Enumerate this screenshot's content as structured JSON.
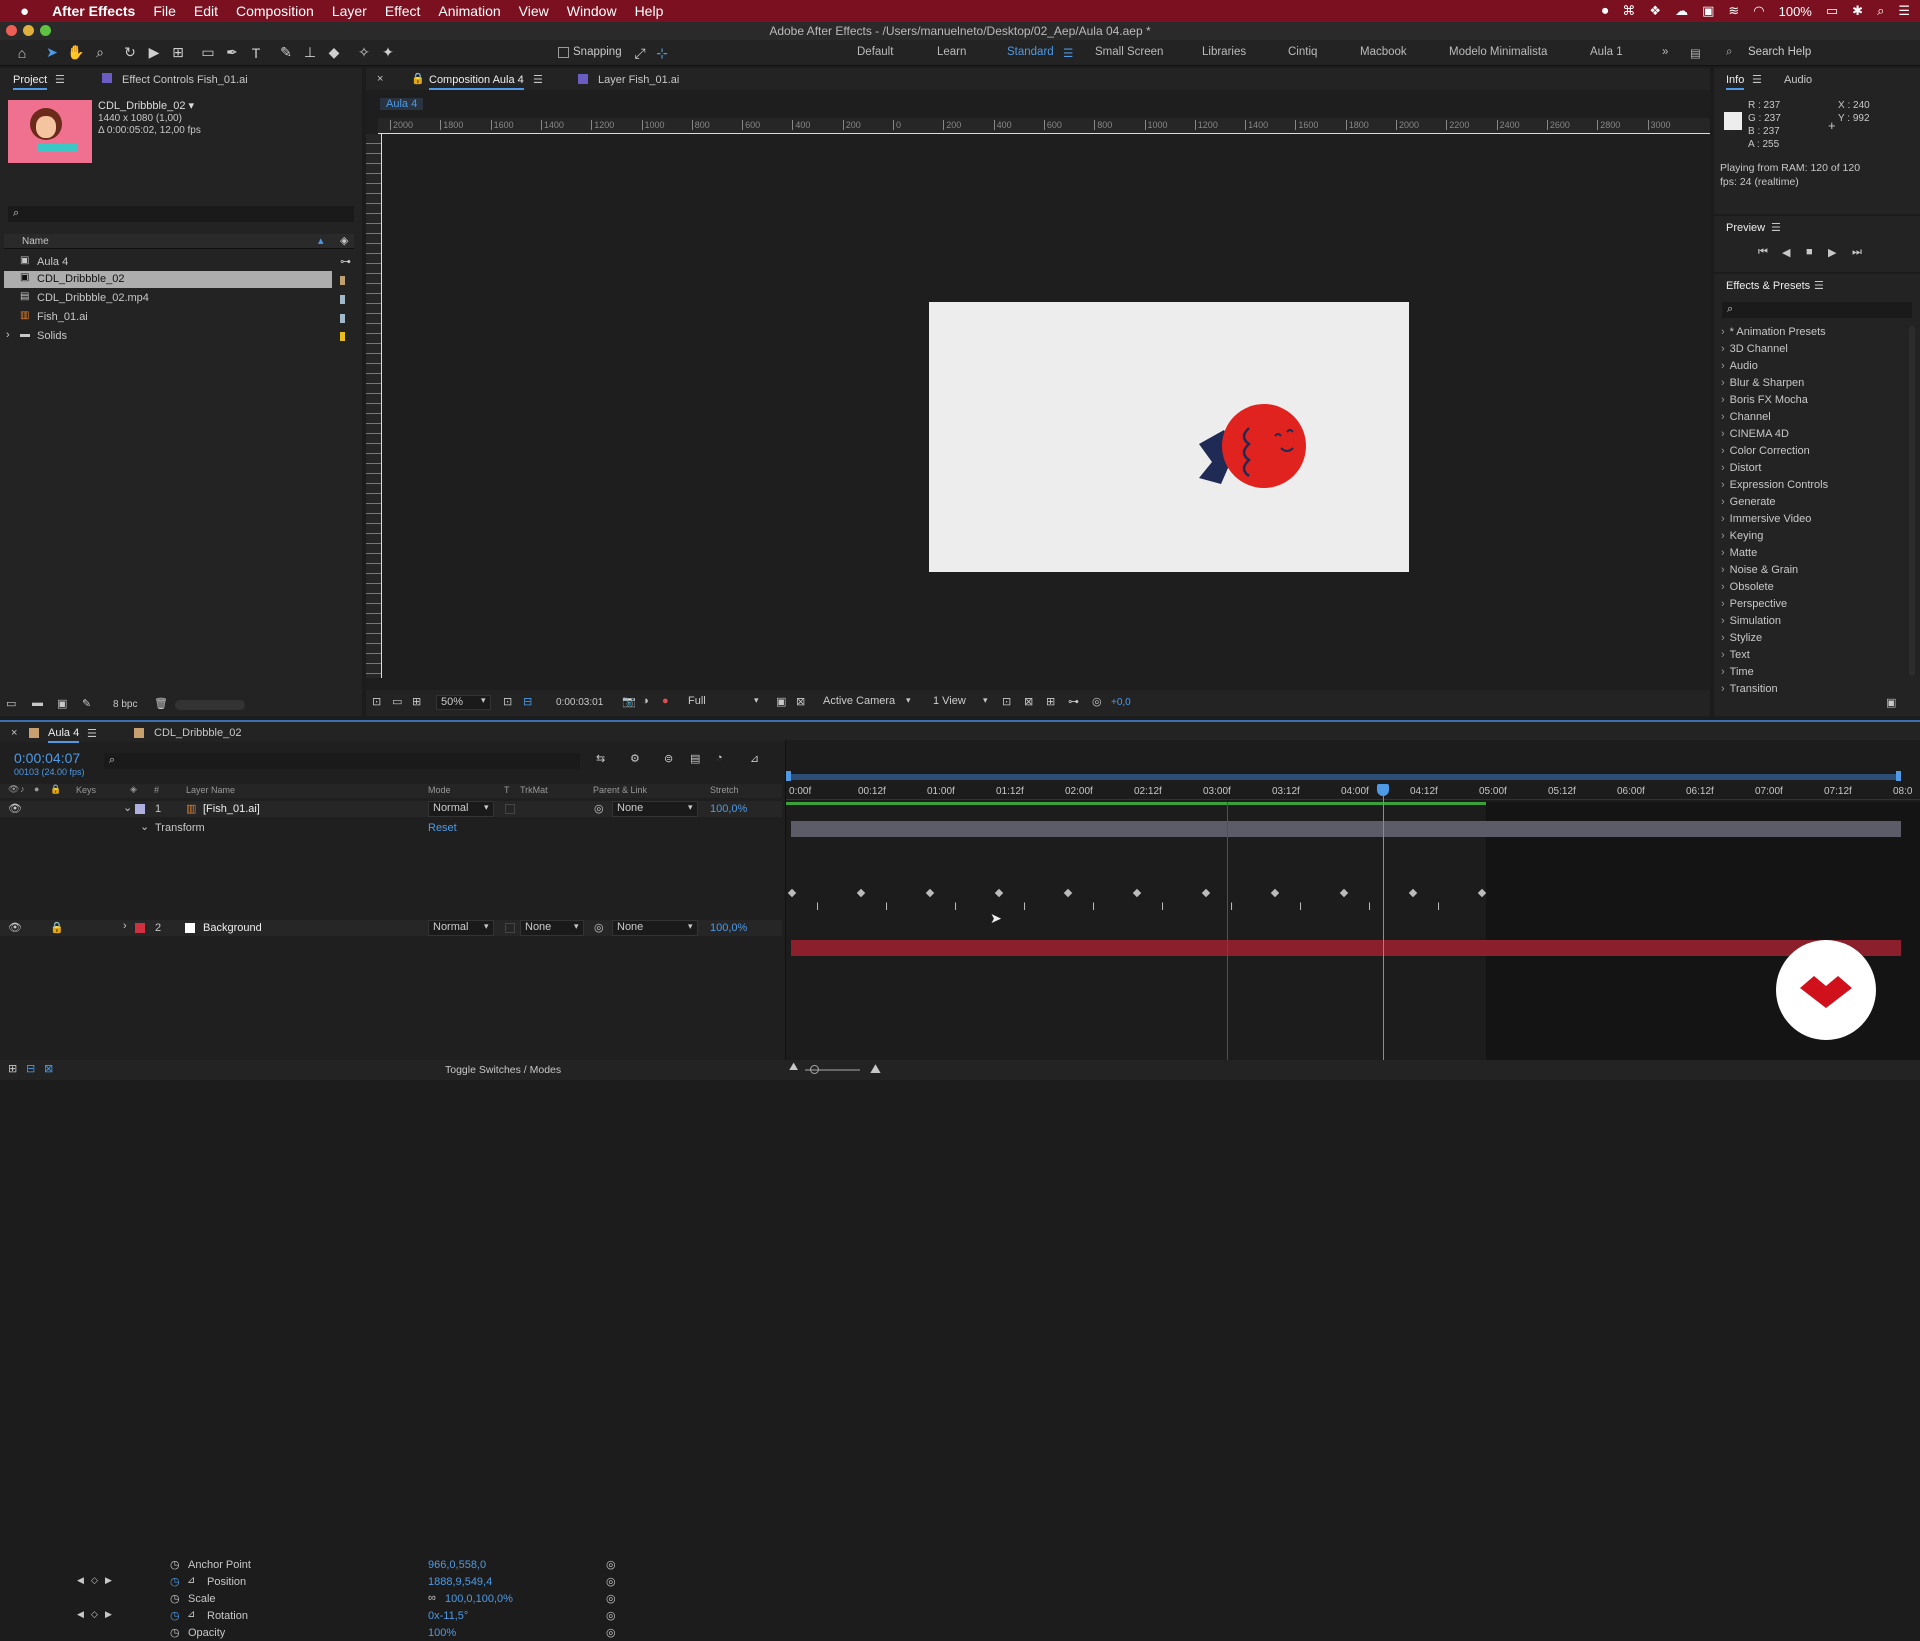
{
  "menubar": {
    "app": "After Effects",
    "items": [
      "File",
      "Edit",
      "Composition",
      "Layer",
      "Effect",
      "Animation",
      "View",
      "Window",
      "Help"
    ],
    "battery": "100%"
  },
  "window_title": "Adobe After Effects - /Users/manuelneto/Desktop/02_Aep/Aula 04.aep *",
  "toolbar": {
    "snapping_label": "Snapping",
    "workspaces": [
      "Default",
      "Learn",
      "Standard",
      "Small Screen",
      "Libraries",
      "Cintiq",
      "Macbook",
      "Modelo Minimalista",
      "Aula 1"
    ],
    "active_workspace": "Standard",
    "search_placeholder": "Search Help"
  },
  "project": {
    "tab_project": "Project",
    "tab_effect_controls": "Effect Controls Fish_01.ai",
    "item_name": "CDL_Dribbble_02 ▾",
    "item_res": "1440 x 1080 (1,00)",
    "item_dur": "Δ 0:00:05:02, 12,00 fps",
    "col_name": "Name",
    "items": [
      "Aula 4",
      "CDL_Dribbble_02",
      "CDL_Dribbble_02.mp4",
      "Fish_01.ai",
      "Solids"
    ],
    "bpc": "8 bpc"
  },
  "comp": {
    "tab_comp": "Composition Aula 4",
    "tab_layer": "Layer Fish_01.ai",
    "breadcrumb": "Aula 4",
    "ruler_labels": [
      "2000",
      "1800",
      "1600",
      "1400",
      "1200",
      "1000",
      "800",
      "600",
      "400",
      "200",
      "0",
      "200",
      "400",
      "600",
      "800",
      "1000",
      "1200",
      "1400",
      "1600",
      "1800",
      "2000",
      "2200",
      "2400",
      "2600",
      "2800",
      "3000"
    ],
    "zoom": "50%",
    "timecode": "0:00:03:01",
    "resolution": "Full",
    "camera": "Active Camera",
    "views": "1 View",
    "exposure": "+0,0"
  },
  "info": {
    "tab_info": "Info",
    "tab_audio": "Audio",
    "r": "R : 237",
    "g": "G : 237",
    "b": "B : 237",
    "a": "A : 255",
    "x": "X : 240",
    "y": "Y : 992",
    "playing": "Playing from RAM: 120 of 120",
    "fps": "fps: 24 (realtime)"
  },
  "preview": {
    "title": "Preview"
  },
  "effects": {
    "title": "Effects & Presets",
    "items": [
      "* Animation Presets",
      "3D Channel",
      "Audio",
      "Blur & Sharpen",
      "Boris FX Mocha",
      "Channel",
      "CINEMA 4D",
      "Color Correction",
      "Distort",
      "Expression Controls",
      "Generate",
      "Immersive Video",
      "Keying",
      "Matte",
      "Noise & Grain",
      "Obsolete",
      "Perspective",
      "Simulation",
      "Stylize",
      "Text",
      "Time",
      "Transition"
    ]
  },
  "timeline": {
    "tab_aula": "Aula 4",
    "tab_cdl": "CDL_Dribbble_02",
    "timecode": "0:00:04:07",
    "frames": "00103 (24.00 fps)",
    "col_keys": "Keys",
    "col_num": "#",
    "col_layer": "Layer Name",
    "col_mode": "Mode",
    "col_t": "T",
    "col_trkmat": "TrkMat",
    "col_parent": "Parent & Link",
    "col_stretch": "Stretch",
    "ruler": [
      "0:00f",
      "00:12f",
      "01:00f",
      "01:12f",
      "02:00f",
      "02:12f",
      "03:00f",
      "03:12f",
      "04:00f",
      "04:12f",
      "05:00f",
      "05:12f",
      "06:00f",
      "06:12f",
      "07:00f",
      "07:12f",
      "08:0"
    ],
    "layer1": {
      "num": "1",
      "name": "[Fish_01.ai]",
      "mode": "Normal",
      "parent": "None",
      "stretch": "100,0%"
    },
    "transform": "Transform",
    "reset": "Reset",
    "props": [
      {
        "name": "Anchor Point",
        "value": "966,0,558,0"
      },
      {
        "name": "Position",
        "value": "1888,9,549,4"
      },
      {
        "name": "Scale",
        "value": "100,0,100,0%"
      },
      {
        "name": "Rotation",
        "value": "0x-11,5°"
      },
      {
        "name": "Opacity",
        "value": "100%"
      }
    ],
    "layer2": {
      "num": "2",
      "name": "Background",
      "mode": "Normal",
      "trkmat": "None",
      "parent": "None",
      "stretch": "100,0%"
    },
    "toggle": "Toggle Switches / Modes"
  },
  "colors": {
    "menubar": "#7a1020",
    "accent": "#4e9ae6",
    "fish": "#e0231e",
    "tail": "#1f2a55",
    "bg_layer": "#8c1f2c"
  }
}
